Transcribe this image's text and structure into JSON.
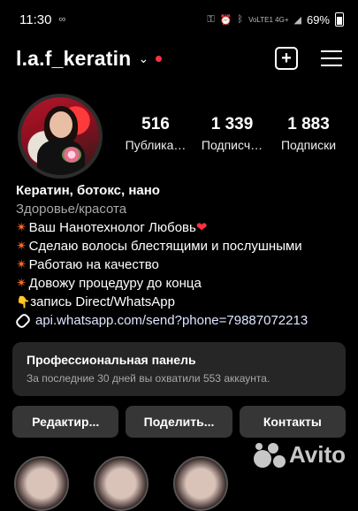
{
  "status_bar": {
    "time": "11:30",
    "notif_icon": "infinity-icon",
    "signal_text": "VoLTE1 4G+",
    "battery": "69%"
  },
  "header": {
    "username": "l.a.f_keratin",
    "chevron": "⌄"
  },
  "stats": [
    {
      "value": "516",
      "label": "Публика…"
    },
    {
      "value": "1 339",
      "label": "Подписч…"
    },
    {
      "value": "1 883",
      "label": "Подписки"
    }
  ],
  "bio": {
    "name": "Кератин, ботокс, нано",
    "category": "Здоровье/красота",
    "lines": [
      "Ваш Нанотехнолог Любовь",
      "Сделаю волосы блестящими и послушными",
      "Работаю на качество",
      "Довожу процедуру до конца",
      "запись Direct/WhatsApp"
    ],
    "link": "api.whatsapp.com/send?phone=79887072213"
  },
  "pro_panel": {
    "title": "Профессиональная панель",
    "subtitle": "За последние 30 дней вы охватили 553 аккаунта."
  },
  "buttons": {
    "edit": "Редактир...",
    "share": "Поделить...",
    "contacts": "Контакты"
  },
  "watermark": {
    "text": "Avito"
  },
  "colors": {
    "background": "#000000",
    "panel": "#262626",
    "button": "#363636",
    "accent_red": "#ff3040"
  }
}
